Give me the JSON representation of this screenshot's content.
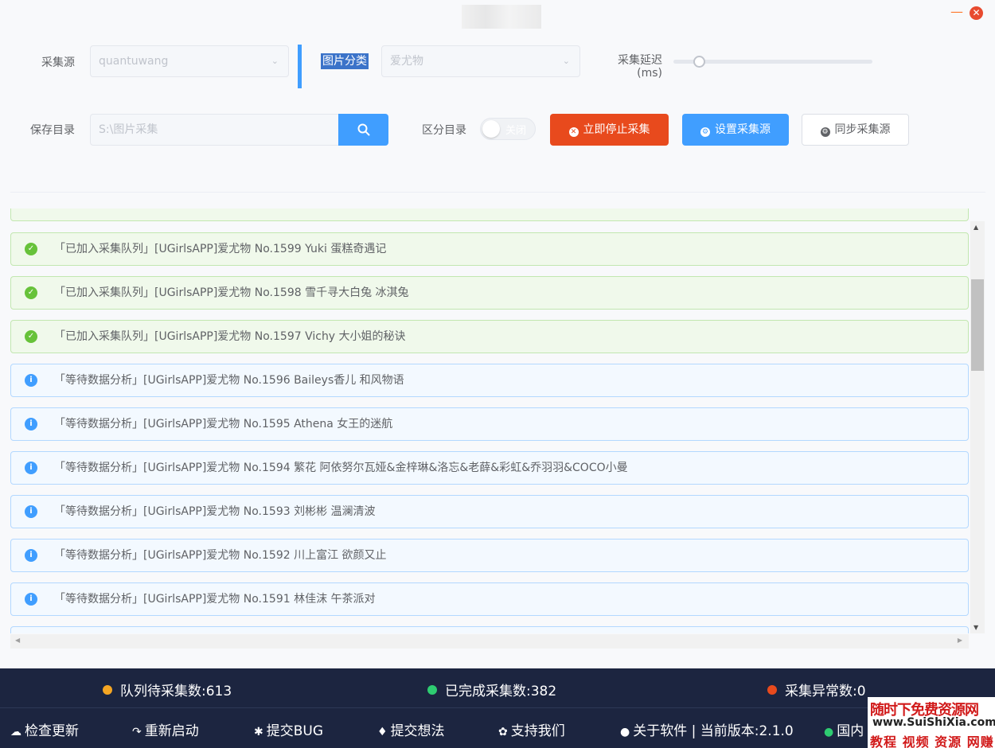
{
  "window": {
    "minimize_glyph": "—",
    "close_glyph": "✕"
  },
  "form": {
    "source_label": "采集源",
    "source_value": "quantuwang",
    "category_label": "图片分类",
    "category_value": "爱尤物",
    "delay_label_line1": "采集延迟",
    "delay_label_line2": "(ms)",
    "delay_value_fraction": 0.13,
    "save_dir_label": "保存目录",
    "save_dir_placeholder": "S:\\图片采集",
    "split_dir_label": "区分目录",
    "split_dir_state": "关闭",
    "stop_button": "立即停止采集",
    "config_button": "设置采集源",
    "sync_button": "同步采集源"
  },
  "log": {
    "items": [
      {
        "type": "success",
        "icon": "check-circle-icon",
        "text": "「已加入采集队列」[UGirlsAPP]爱尤物 No.1599 Yuki 蛋糕奇遇记"
      },
      {
        "type": "success",
        "icon": "check-circle-icon",
        "text": "「已加入采集队列」[UGirlsAPP]爱尤物 No.1598 雪千寻大白兔 冰淇兔"
      },
      {
        "type": "success",
        "icon": "check-circle-icon",
        "text": "「已加入采集队列」[UGirlsAPP]爱尤物 No.1597 Vichy 大小姐的秘诀"
      },
      {
        "type": "info",
        "icon": "info-circle-icon",
        "text": "「等待数据分析」[UGirlsAPP]爱尤物 No.1596 Baileys香儿 和风物语"
      },
      {
        "type": "info",
        "icon": "info-circle-icon",
        "text": "「等待数据分析」[UGirlsAPP]爱尤物 No.1595 Athena 女王的迷航"
      },
      {
        "type": "info",
        "icon": "info-circle-icon",
        "text": "「等待数据分析」[UGirlsAPP]爱尤物 No.1594 繁花 阿依努尔瓦娅&金梓琳&洛忘&老薛&彩虹&乔羽羽&COCO小曼"
      },
      {
        "type": "info",
        "icon": "info-circle-icon",
        "text": "「等待数据分析」[UGirlsAPP]爱尤物 No.1593 刘彬彬 温澜清波"
      },
      {
        "type": "info",
        "icon": "info-circle-icon",
        "text": "「等待数据分析」[UGirlsAPP]爱尤物 No.1592 川上富江 欲颜又止"
      },
      {
        "type": "info",
        "icon": "info-circle-icon",
        "text": "「等待数据分析」[UGirlsAPP]爱尤物 No.1591 林佳沫 午茶派对"
      }
    ]
  },
  "status": {
    "queued_label": "队列待采集数:",
    "queued_value": "613",
    "done_label": "已完成采集数:",
    "done_value": "382",
    "error_label": "采集异常数:",
    "error_value": "0",
    "colors": {
      "queued": "#f5a623",
      "done": "#2ecc71",
      "error": "#e84a1d"
    }
  },
  "footer": {
    "check_update": "检查更新",
    "restart": "重新启动",
    "submit_bug": "提交BUG",
    "submit_idea": "提交想法",
    "support": "支持我们",
    "about": "关于软件 | 当前版本:2.1.0",
    "region": "国内"
  },
  "watermark": {
    "line1": "随时下免费资源网",
    "line2": "www.SuiShiXia.com",
    "line3": "教程 视频 资源 网赚"
  }
}
